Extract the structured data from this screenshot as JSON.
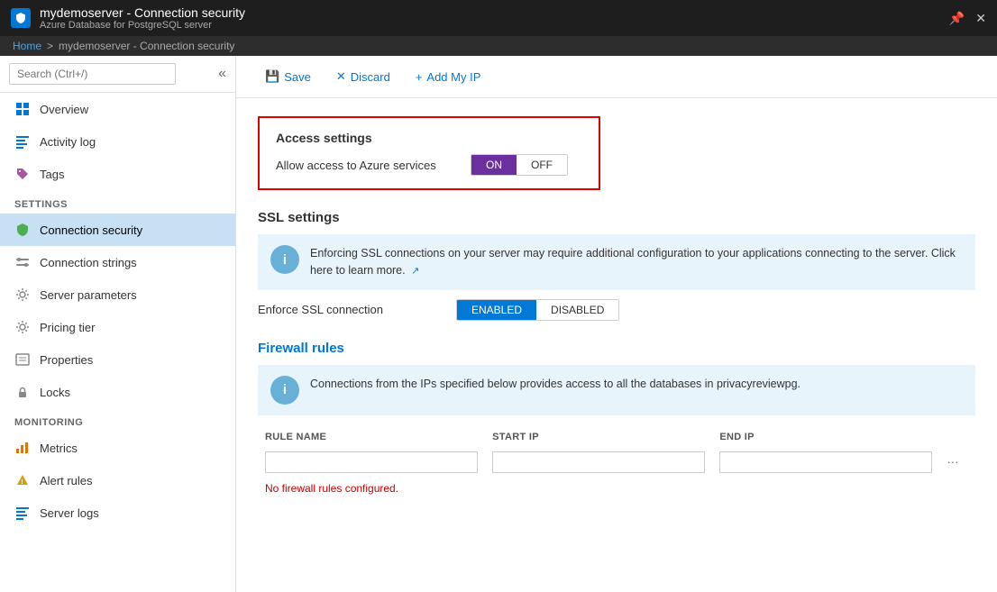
{
  "titleBar": {
    "title": "mydemoserver - Connection security",
    "subtitle": "Azure Database for PostgreSQL server",
    "pinIcon": "📌",
    "closeIcon": "✕"
  },
  "breadcrumb": {
    "home": "Home",
    "separator": ">",
    "current": "mydemoserver - Connection security"
  },
  "sidebar": {
    "searchPlaceholder": "Search (Ctrl+/)",
    "collapseIcon": "«",
    "navItems": [
      {
        "id": "overview",
        "label": "Overview",
        "icon": "overview"
      },
      {
        "id": "activity-log",
        "label": "Activity log",
        "icon": "activity"
      },
      {
        "id": "tags",
        "label": "Tags",
        "icon": "tags"
      }
    ],
    "settingsLabel": "SETTINGS",
    "settingsItems": [
      {
        "id": "connection-security",
        "label": "Connection security",
        "icon": "shield",
        "active": true
      },
      {
        "id": "connection-strings",
        "label": "Connection strings",
        "icon": "conn-str"
      },
      {
        "id": "server-parameters",
        "label": "Server parameters",
        "icon": "gear"
      },
      {
        "id": "pricing-tier",
        "label": "Pricing tier",
        "icon": "gear2"
      },
      {
        "id": "properties",
        "label": "Properties",
        "icon": "properties"
      },
      {
        "id": "locks",
        "label": "Locks",
        "icon": "lock"
      }
    ],
    "monitoringLabel": "MONITORING",
    "monitoringItems": [
      {
        "id": "metrics",
        "label": "Metrics",
        "icon": "metrics"
      },
      {
        "id": "alert-rules",
        "label": "Alert rules",
        "icon": "alert"
      },
      {
        "id": "server-logs",
        "label": "Server logs",
        "icon": "server-logs"
      }
    ]
  },
  "toolbar": {
    "saveLabel": "Save",
    "discardLabel": "Discard",
    "addMyIpLabel": "Add My IP"
  },
  "accessSettings": {
    "title": "Access settings",
    "allowLabel": "Allow access to Azure services",
    "toggleOn": "ON",
    "toggleOff": "OFF",
    "activeState": "ON"
  },
  "sslSettings": {
    "title": "SSL settings",
    "infoText": "Enforcing SSL connections on your server may require additional configuration to your applications connecting to the server. Click here to learn more.",
    "enforceLabel": "Enforce SSL connection",
    "enabledLabel": "ENABLED",
    "disabledLabel": "DISABLED",
    "activeState": "ENABLED"
  },
  "firewallRules": {
    "title": "Firewall rules",
    "infoText": "Connections from the IPs specified below provides access to all the databases in privacyreviewpg.",
    "columns": {
      "ruleName": "RULE NAME",
      "startIp": "START IP",
      "endIp": "END IP"
    },
    "noRulesText": "No firewall rules configured.",
    "rows": [
      {
        "ruleName": "",
        "startIp": "",
        "endIp": ""
      }
    ]
  }
}
